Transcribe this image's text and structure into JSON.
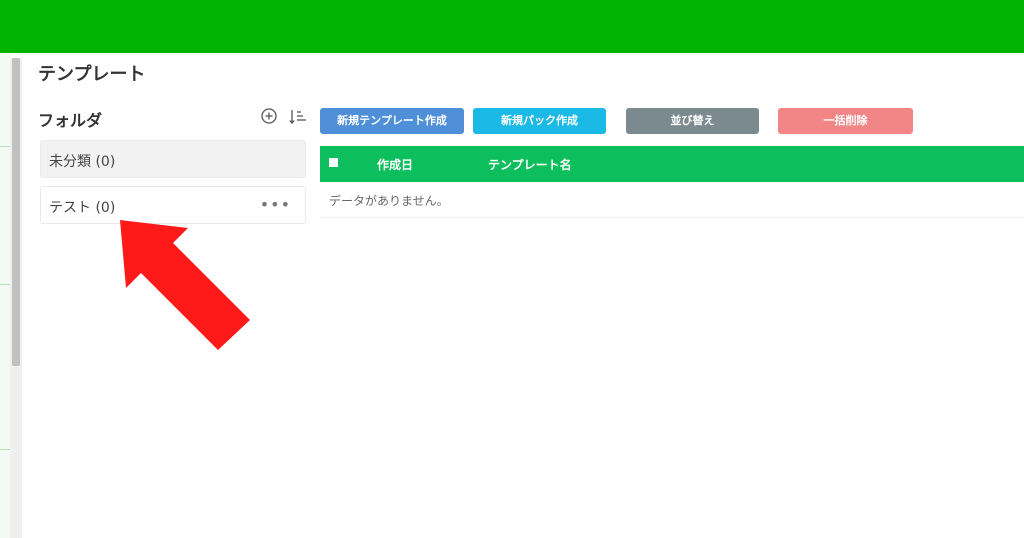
{
  "page": {
    "title": "テンプレート"
  },
  "folders": {
    "title": "フォルダ",
    "items": [
      {
        "label": "未分類 (0)",
        "selected": true
      },
      {
        "label": "テスト (0)",
        "selected": false,
        "more": "•••"
      }
    ]
  },
  "toolbar": {
    "new_template": "新規テンプレート作成",
    "new_pack": "新規パック作成",
    "sort": "並び替え",
    "bulk_delete": "一括削除"
  },
  "table": {
    "headers": [
      "作成日",
      "テンプレート名"
    ],
    "empty_message": "データがありません。"
  },
  "colors": {
    "topbar": "#00b300",
    "table_header": "#0cbf5c",
    "btn_new_template": "#4f8fd8",
    "btn_new_pack": "#1ab9e6",
    "btn_sort": "#7a8a8e",
    "btn_bulk_delete": "#f28686",
    "annotation_arrow": "#ff1a1a"
  },
  "icons": {
    "folder_add": "plus-circle-icon",
    "folder_sort": "sort-list-icon",
    "folder_more": "more-horizontal-icon",
    "annotation": "red-arrow-pointer"
  }
}
